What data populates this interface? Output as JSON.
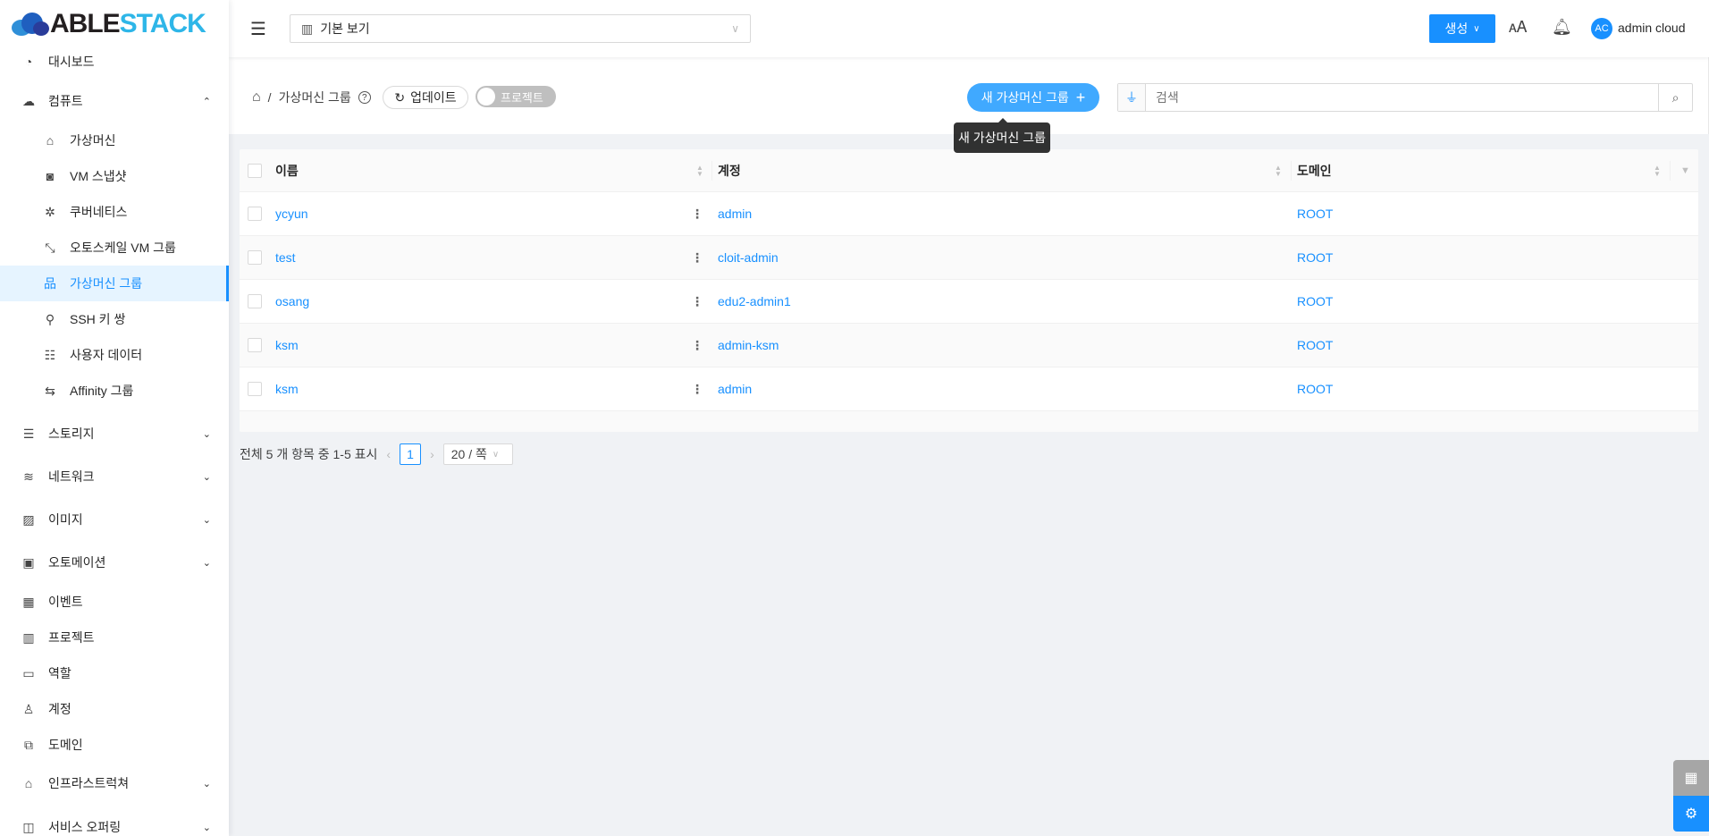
{
  "logo": {
    "part1": "ABLE",
    "part2": "STACK"
  },
  "header": {
    "project_select": "기본 보기",
    "create_label": "생성",
    "user_initials": "AC",
    "user_name": "admin cloud"
  },
  "sidebar": {
    "items": [
      {
        "label": "대시보드",
        "icon": "dashboard-icon"
      },
      {
        "label": "컴퓨트",
        "icon": "cloud-icon",
        "expanded": true
      },
      {
        "label": "가상머신",
        "icon": "desktop-cloud-icon"
      },
      {
        "label": "VM 스냅샷",
        "icon": "camera-icon"
      },
      {
        "label": "쿠버네티스",
        "icon": "kubernetes-icon"
      },
      {
        "label": "오토스케일 VM 그룹",
        "icon": "expand-icon"
      },
      {
        "label": "가상머신 그룹",
        "icon": "cluster-icon",
        "active": true
      },
      {
        "label": "SSH 키 쌍",
        "icon": "key-icon"
      },
      {
        "label": "사용자 데이터",
        "icon": "document-user-icon"
      },
      {
        "label": "Affinity 그룹",
        "icon": "swap-icon"
      },
      {
        "label": "스토리지",
        "icon": "database-icon"
      },
      {
        "label": "네트워크",
        "icon": "wifi-icon"
      },
      {
        "label": "이미지",
        "icon": "picture-icon"
      },
      {
        "label": "오토메이션",
        "icon": "appstore-add-icon"
      },
      {
        "label": "이벤트",
        "icon": "calendar-check-icon"
      },
      {
        "label": "프로젝트",
        "icon": "project-icon"
      },
      {
        "label": "역할",
        "icon": "idcard-icon"
      },
      {
        "label": "계정",
        "icon": "team-icon"
      },
      {
        "label": "도메인",
        "icon": "block-icon"
      },
      {
        "label": "인프라스트럭쳐",
        "icon": "bank-icon"
      },
      {
        "label": "서비스 오퍼링",
        "icon": "shopping-icon"
      }
    ]
  },
  "breadcrumb": {
    "current": "가상머신 그룹"
  },
  "toolbar": {
    "refresh_label": "업데이트",
    "project_toggle": "프로젝트",
    "new_button": "새 가상머신 그룹",
    "tooltip": "새 가상머신 그룹",
    "search_placeholder": "검색"
  },
  "table": {
    "columns": [
      "이름",
      "계정",
      "도메인"
    ],
    "rows": [
      {
        "name": "ycyun",
        "account": "admin",
        "domain": "ROOT"
      },
      {
        "name": "test",
        "account": "cloit-admin",
        "domain": "ROOT"
      },
      {
        "name": "osang",
        "account": "edu2-admin1",
        "domain": "ROOT"
      },
      {
        "name": "ksm",
        "account": "admin-ksm",
        "domain": "ROOT"
      },
      {
        "name": "ksm",
        "account": "admin",
        "domain": "ROOT"
      }
    ]
  },
  "pagination": {
    "summary": "전체 5 개 항목 중 1-5 표시",
    "current_page": "1",
    "page_size": "20 / 쪽"
  },
  "colors": {
    "primary": "#1890ff",
    "new_button": "#40a9ff"
  }
}
